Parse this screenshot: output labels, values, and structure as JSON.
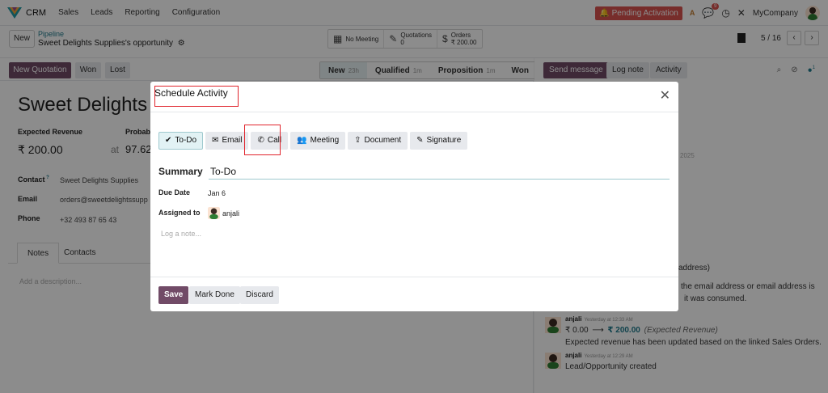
{
  "navbar": {
    "app_name": "CRM",
    "menu": [
      "Sales",
      "Leads",
      "Reporting",
      "Configuration"
    ],
    "pending_label": "Pending Activation",
    "chat_count": "9",
    "company": "MyCompany"
  },
  "control": {
    "new_label": "New",
    "breadcrumb_parent": "Pipeline",
    "breadcrumb_current": "Sweet Delights Supplies's opportunity",
    "smart_meeting": "No Meeting",
    "smart_quotations_label": "Quotations",
    "smart_quotations_count": "0",
    "smart_orders_label": "Orders",
    "smart_orders_amount": "₹ 200.00",
    "pager": "5 / 16"
  },
  "statusbar": {
    "new_quotation": "New Quotation",
    "won": "Won",
    "lost": "Lost",
    "stages": [
      {
        "name": "New",
        "time": "23h"
      },
      {
        "name": "Qualified",
        "time": "1m"
      },
      {
        "name": "Proposition",
        "time": "1m"
      },
      {
        "name": "Won",
        "time": ""
      }
    ]
  },
  "form": {
    "title": "Sweet Delights S",
    "expected_revenue_label": "Expected Revenue",
    "expected_revenue": "₹ 200.00",
    "probability_label": "Probab",
    "probability_at": "at",
    "probability_value": "97.62",
    "contact_label": "Contact",
    "contact_value": "Sweet Delights Supplies",
    "email_label": "Email",
    "email_value": "orders@sweetdelightssupp",
    "phone_label": "Phone",
    "phone_value": "+32 493 87 65 43",
    "tabs": [
      "Notes",
      "Contacts"
    ],
    "description_placeholder": "Add a description..."
  },
  "chatter": {
    "send_message": "Send message",
    "log_note": "Log note",
    "activity": "Activity",
    "followers": "1",
    "date_fragment": "2025",
    "fragment_1": "address)",
    "fragment_2": "the email address or email address is",
    "fragment_3": "it was consumed.",
    "message_1": {
      "author": "anjali",
      "time": "Yesterday at 12:33 AM",
      "old": "₹ 0.00",
      "arrow": "⟶",
      "new": "₹ 200.00",
      "field": "(Expected Revenue)",
      "body": "Expected revenue has been updated based on the linked Sales Orders."
    },
    "message_2": {
      "author": "anjali",
      "time": "Yesterday at 12:29 AM",
      "body": "Lead/Opportunity created"
    }
  },
  "modal": {
    "title": "Schedule Activity",
    "activity_types": [
      {
        "label": "To-Do",
        "icon": "check-icon"
      },
      {
        "label": "Email",
        "icon": "envelope-icon"
      },
      {
        "label": "Call",
        "icon": "phone-icon"
      },
      {
        "label": "Meeting",
        "icon": "users-icon"
      },
      {
        "label": "Document",
        "icon": "upload-icon"
      },
      {
        "label": "Signature",
        "icon": "pencil-square-icon"
      }
    ],
    "selected_type": "To-Do",
    "summary_label": "Summary",
    "summary_value": "To-Do",
    "due_date_label": "Due Date",
    "due_date_value": "Jan 6",
    "assigned_label": "Assigned to",
    "assigned_value": "anjali",
    "note_placeholder": "Log a note...",
    "save": "Save",
    "mark_done": "Mark Done",
    "discard": "Discard"
  },
  "colors": {
    "primary": "#714b67",
    "highlight_box": "#e0242c",
    "pending": "#d9534f",
    "teal": "#1f7a8c"
  }
}
